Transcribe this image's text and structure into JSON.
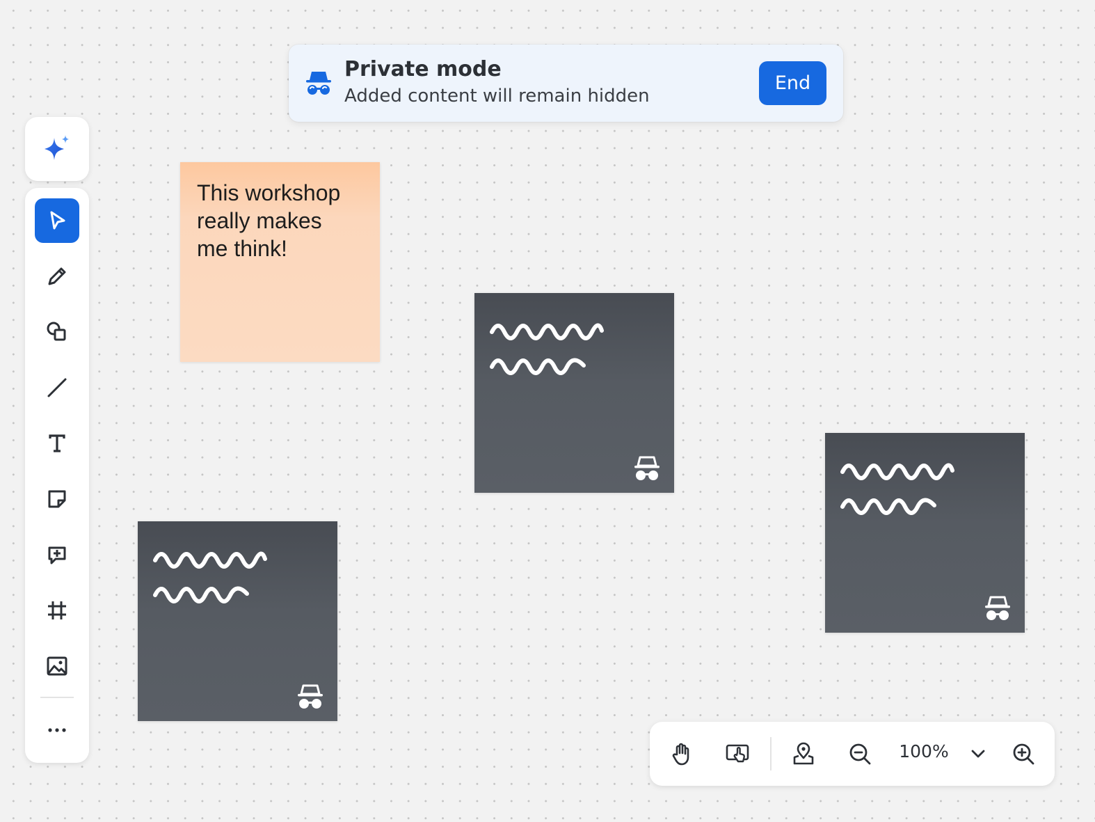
{
  "banner": {
    "title": "Private mode",
    "subtitle": "Added content will remain hidden",
    "end_label": "End",
    "icon": "incognito-icon"
  },
  "ai_button": {
    "icon": "sparkle-ai-icon"
  },
  "toolbar": {
    "tools": [
      {
        "name": "select",
        "icon": "cursor-pointer-icon",
        "active": true
      },
      {
        "name": "pen",
        "icon": "pencil-icon",
        "active": false
      },
      {
        "name": "shapes",
        "icon": "shapes-icon",
        "active": false
      },
      {
        "name": "line",
        "icon": "line-icon",
        "active": false
      },
      {
        "name": "text",
        "icon": "text-icon",
        "active": false
      },
      {
        "name": "sticky-note",
        "icon": "sticky-note-icon",
        "active": false
      },
      {
        "name": "comment",
        "icon": "add-comment-icon",
        "active": false
      },
      {
        "name": "frame",
        "icon": "frame-icon",
        "active": false
      },
      {
        "name": "image",
        "icon": "image-icon",
        "active": false
      },
      {
        "name": "more",
        "icon": "more-icon",
        "active": false
      }
    ]
  },
  "notes": {
    "visible_note_text": "This workshop really makes me think!",
    "hidden_note_icon": "incognito-icon"
  },
  "bottom_bar": {
    "zoom_level": "100%",
    "items": [
      "hand-icon",
      "present-cursor-icon",
      "map-pin-icon",
      "zoom-out-icon",
      "chevron-down-icon",
      "zoom-in-icon"
    ]
  },
  "colors": {
    "accent": "#1769e0",
    "banner_bg": "#eef4fc",
    "note_orange": "#fcd7bc",
    "note_dark": "#52575e",
    "canvas_bg": "#f2f2f2"
  }
}
